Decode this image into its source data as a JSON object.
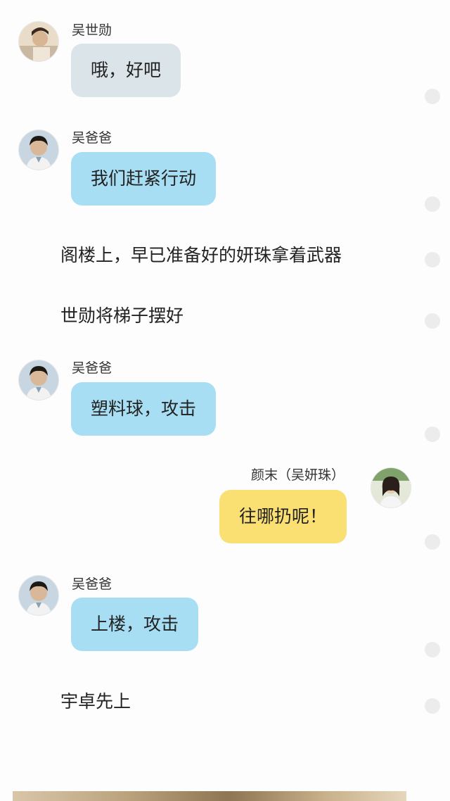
{
  "messages": [
    {
      "sender": "吴世勋",
      "text": "哦，好吧"
    },
    {
      "sender": "吴爸爸",
      "text": "我们赶紧行动"
    },
    {
      "narration": "阁楼上，早已准备好的妍珠拿着武器"
    },
    {
      "narration": "世勋将梯子摆好"
    },
    {
      "sender": "吴爸爸",
      "text": "塑料球，攻击"
    },
    {
      "sender": "颜末（吴妍珠）",
      "text": "往哪扔呢！"
    },
    {
      "sender": "吴爸爸",
      "text": "上楼，攻击"
    },
    {
      "narration": "宇卓先上"
    }
  ],
  "colors": {
    "bubble_gray": "#dbe5e9",
    "bubble_blue": "#a7def3",
    "bubble_yellow": "#fadf73",
    "background": "#fdfdfd"
  },
  "icons": {
    "read_indicator": "circle-dot-icon"
  }
}
